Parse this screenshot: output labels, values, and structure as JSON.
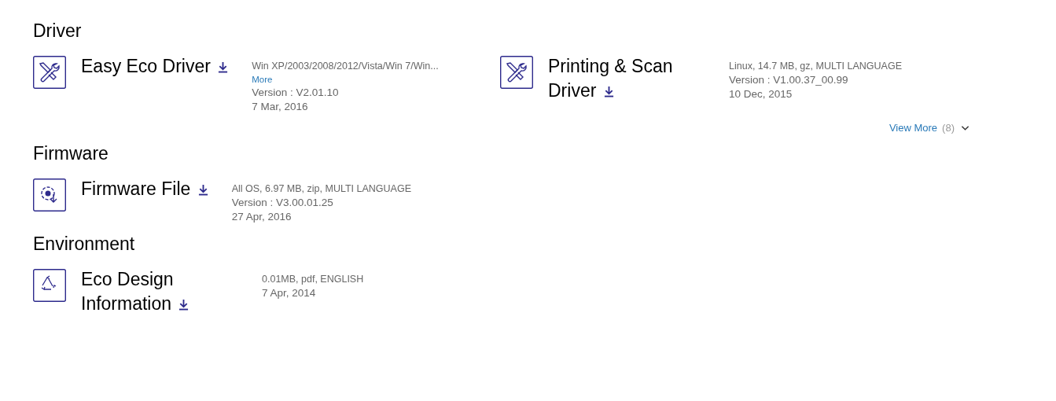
{
  "sections": [
    {
      "title": "Driver",
      "items": [
        {
          "kind": "tools",
          "title": "Easy Eco Driver",
          "description": "Win XP/2003/2008/2012/Vista/Win 7/Win...",
          "more": "More",
          "version": "Version : V2.01.10",
          "date": "7 Mar, 2016"
        },
        {
          "kind": "tools",
          "title": "Printing & Scan Driver",
          "description": "Linux, 14.7 MB, gz, MULTI LANGUAGE",
          "version": "Version : V1.00.37_00.99",
          "date": "10 Dec, 2015"
        }
      ],
      "view_more": {
        "label": "View More",
        "count": "(8)"
      }
    },
    {
      "title": "Firmware",
      "items": [
        {
          "kind": "gear",
          "title": "Firmware File",
          "description": "All OS, 6.97 MB, zip, MULTI LANGUAGE",
          "version": "Version : V3.00.01.25",
          "date": "27 Apr, 2016"
        }
      ]
    },
    {
      "title": "Environment",
      "items": [
        {
          "kind": "recycle",
          "title": "Eco Design Information",
          "description": "0.01MB, pdf, ENGLISH",
          "date": "7 Apr, 2014"
        }
      ]
    }
  ]
}
